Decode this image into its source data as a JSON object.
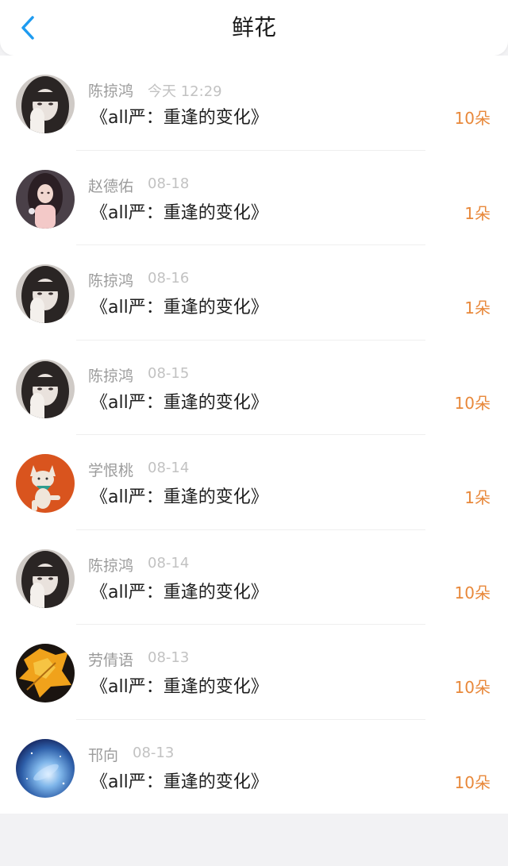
{
  "header": {
    "title": "鲜花",
    "back_icon": "chevron-left-icon",
    "accent": "#1e9bf0"
  },
  "rows": [
    {
      "name": "陈掠鸿",
      "date": "今天 12:29",
      "book": "《all严：重逢的变化》",
      "count": "10朵",
      "avatar": "girl-photo"
    },
    {
      "name": "赵德佑",
      "date": "08-18",
      "book": "《all严：重逢的变化》",
      "count": "1朵",
      "avatar": "illustrated-girl"
    },
    {
      "name": "陈掠鸿",
      "date": "08-16",
      "book": "《all严：重逢的变化》",
      "count": "1朵",
      "avatar": "girl-photo"
    },
    {
      "name": "陈掠鸿",
      "date": "08-15",
      "book": "《all严：重逢的变化》",
      "count": "10朵",
      "avatar": "girl-photo"
    },
    {
      "name": "学恨桃",
      "date": "08-14",
      "book": "《all严：重逢的变化》",
      "count": "1朵",
      "avatar": "cat-cartoon"
    },
    {
      "name": "陈掠鸿",
      "date": "08-14",
      "book": "《all严：重逢的变化》",
      "count": "10朵",
      "avatar": "girl-photo"
    },
    {
      "name": "劳倩语",
      "date": "08-13",
      "book": "《all严：重逢的变化》",
      "count": "10朵",
      "avatar": "autumn-leaf"
    },
    {
      "name": "邗向",
      "date": "08-13",
      "book": "《all严：重逢的变化》",
      "count": "10朵",
      "avatar": "galaxy"
    }
  ],
  "colors": {
    "count": "#e8883a",
    "name": "#9b9b9b",
    "date": "#c2c2c2"
  }
}
